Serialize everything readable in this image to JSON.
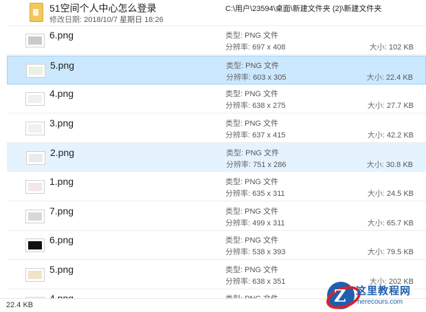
{
  "folder": {
    "name": "51空间个人中心怎么登录",
    "date_label": "修改日期:",
    "date": "2018/10/7 星期日 18:26",
    "path": "C:\\用户\\23594\\桌面\\新建文件夹 (2)\\新建文件夹"
  },
  "labels": {
    "type": "类型:",
    "dims": "分辨率:",
    "size": "大小:"
  },
  "files": [
    {
      "name": "6.png",
      "type": "PNG 文件",
      "dims": "697 x 408",
      "size": "102 KB",
      "state": "normal",
      "thumb": "#c9c9c9"
    },
    {
      "name": "5.png",
      "type": "PNG 文件",
      "dims": "603 x 305",
      "size": "22.4 KB",
      "state": "selected",
      "thumb": "#e8f1e6"
    },
    {
      "name": "4.png",
      "type": "PNG 文件",
      "dims": "638 x 275",
      "size": "27.7 KB",
      "state": "normal",
      "thumb": "#eef0f3"
    },
    {
      "name": "3.png",
      "type": "PNG 文件",
      "dims": "637 x 415",
      "size": "42.2 KB",
      "state": "normal",
      "thumb": "#f1f1f1"
    },
    {
      "name": "2.png",
      "type": "PNG 文件",
      "dims": "751 x 286",
      "size": "30.8 KB",
      "state": "hover",
      "thumb": "#eaeaea"
    },
    {
      "name": "1.png",
      "type": "PNG 文件",
      "dims": "635 x 311",
      "size": "24.5 KB",
      "state": "normal",
      "thumb": "#f3e6ea"
    },
    {
      "name": "7.png",
      "type": "PNG 文件",
      "dims": "499 x 311",
      "size": "65.7 KB",
      "state": "normal",
      "thumb": "#d8d8d8"
    },
    {
      "name": "6.png",
      "type": "PNG 文件",
      "dims": "538 x 393",
      "size": "79.5 KB",
      "state": "normal",
      "thumb": "#111111"
    },
    {
      "name": "5.png",
      "type": "PNG 文件",
      "dims": "638 x 351",
      "size": "202 KB",
      "state": "normal",
      "thumb": "#efe3c8"
    },
    {
      "name": "4.png",
      "type": "PNG 文件",
      "dims": "",
      "size": "",
      "state": "normal",
      "thumb": "#eeeeee"
    }
  ],
  "status": {
    "selection_size": "22.4 KB"
  },
  "watermark": {
    "logo_letter": "Z",
    "title": "这里教程网",
    "url": "herecours.com"
  }
}
